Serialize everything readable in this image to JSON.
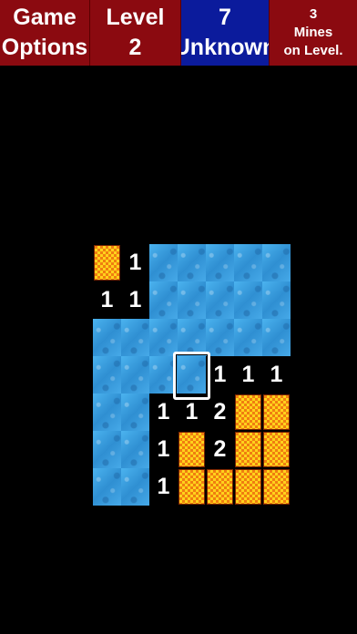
{
  "toolbar": {
    "game_options": [
      "Game",
      "Options"
    ],
    "level": [
      "Level",
      "2"
    ],
    "unknown": [
      "7",
      "Unknown"
    ],
    "mines": [
      "3",
      "Mines",
      "on Level."
    ]
  },
  "colors": {
    "toolbar_red": "#8b0a10",
    "toolbar_blue": "#0b1b9c",
    "water": "#3aa0e2",
    "flag_orange": "#f07e10",
    "flag_yellow": "#ffd21c"
  },
  "board": {
    "cols": 7,
    "rows": 7,
    "legend": "W = covered water tile, F = flagged tile, . = revealed empty, digit = adjacent mine count",
    "grid": [
      "F1WWWWW",
      "11WWWWW",
      "WWWWWWW",
      "WWWW111",
      "WW112FF",
      "WW1F2FF",
      "WW1FFFF"
    ],
    "cursor": {
      "row": 3,
      "col": 3
    }
  }
}
